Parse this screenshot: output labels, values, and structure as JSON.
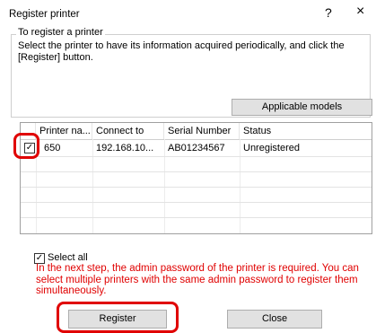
{
  "window": {
    "title": "Register printer",
    "help_label": "?",
    "close_label": "×"
  },
  "group": {
    "legend": "To register a printer",
    "description": "Select the printer to have its information acquired periodically, and click the [Register] button."
  },
  "buttons": {
    "applicable_models": "Applicable models",
    "register": "Register",
    "close": "Close"
  },
  "table": {
    "columns": [
      "Printer na...",
      "Connect to",
      "Serial Number",
      "Status"
    ],
    "rows": [
      {
        "checked": true,
        "name": "650",
        "connect_to": "192.168.10...",
        "serial": "AB01234567",
        "status": "Unregistered"
      }
    ]
  },
  "select_all": {
    "label": "Select all",
    "checked": true
  },
  "notice": "In the next step, the admin password of the printer is required. You can select multiple printers with the same admin password to register them simultaneously.",
  "colors": {
    "highlight_red": "#e00000",
    "button_bg": "#e1e1e1"
  }
}
